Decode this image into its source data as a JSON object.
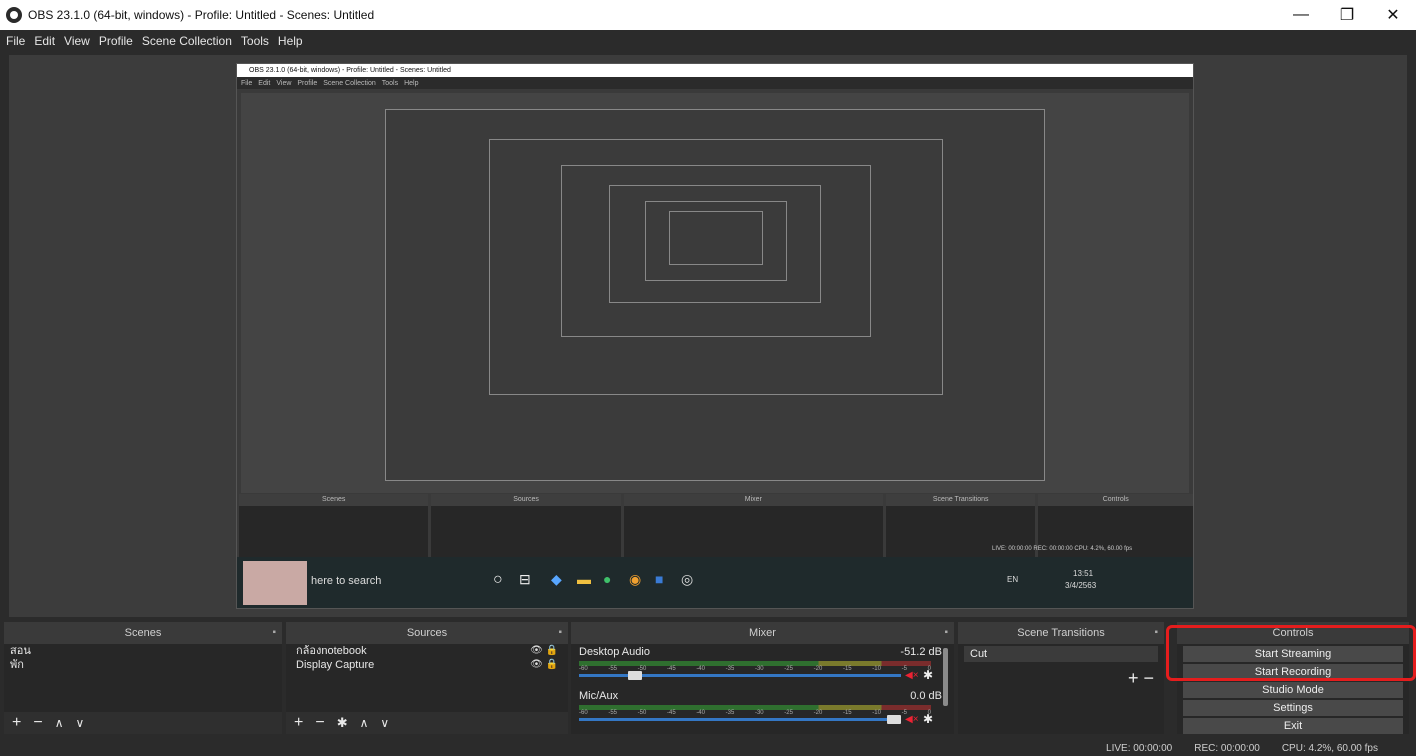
{
  "window": {
    "title": "OBS 23.1.0 (64-bit, windows) - Profile: Untitled - Scenes: Untitled",
    "minimize": "—",
    "maximize": "❐",
    "close": "✕"
  },
  "menu": [
    "File",
    "Edit",
    "View",
    "Profile",
    "Scene Collection",
    "Tools",
    "Help"
  ],
  "nested_preview": {
    "title": "OBS 23.1.0 (64-bit, windows) - Profile: Untitled - Scenes: Untitled",
    "menu": [
      "File",
      "Edit",
      "View",
      "Profile",
      "Scene Collection",
      "Tools",
      "Help"
    ],
    "panels": [
      "Scenes",
      "Sources",
      "Mixer",
      "Scene Transitions",
      "Controls"
    ],
    "search_text": "here to search",
    "clock_time": "13:51",
    "clock_date": "3/4/2563",
    "lang": "EN",
    "status": "LIVE: 00:00:00   REC: 00:00:00   CPU: 4.2%, 60.00 fps"
  },
  "docks": {
    "scenes": {
      "title": "Scenes",
      "items": [
        "สอน",
        "พัก"
      ]
    },
    "sources": {
      "title": "Sources",
      "items": [
        "กล้องnotebook",
        "Display Capture"
      ]
    },
    "mixer": {
      "title": "Mixer",
      "channels": [
        {
          "name": "Desktop Audio",
          "db": "-51.2 dB",
          "volume": 0.16
        },
        {
          "name": "Mic/Aux",
          "db": "0.0 dB",
          "volume": 1.0
        }
      ],
      "ticks": [
        "-60",
        "-55",
        "-50",
        "-45",
        "-40",
        "-35",
        "-30",
        "-25",
        "-20",
        "-15",
        "-10",
        "-5",
        "0"
      ]
    },
    "transitions": {
      "title": "Scene Transitions",
      "selected": "Cut"
    },
    "controls": {
      "title": "Controls",
      "buttons": [
        "Start Streaming",
        "Start Recording",
        "Studio Mode",
        "Settings",
        "Exit"
      ]
    }
  },
  "status": {
    "live": "LIVE: 00:00:00",
    "rec": "REC: 00:00:00",
    "cpu": "CPU: 4.2%, 60.00 fps"
  },
  "colors": {
    "highlight": "#e51d1d",
    "accent_blue": "#3477c4"
  }
}
